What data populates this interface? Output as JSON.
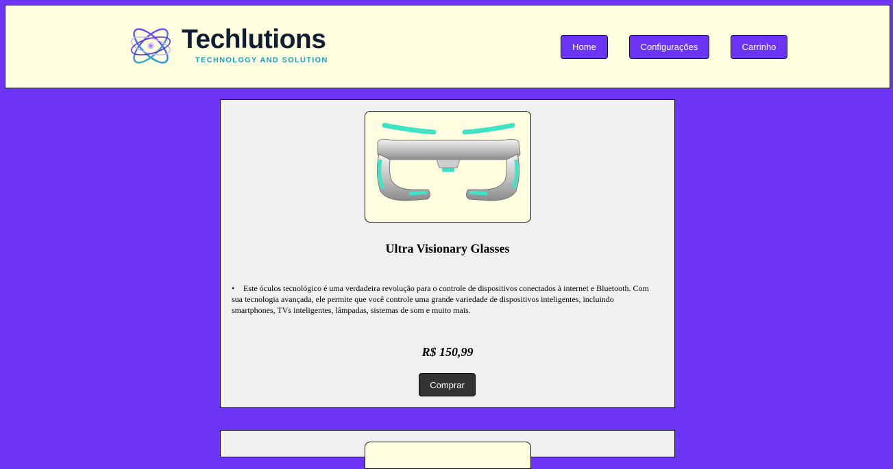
{
  "header": {
    "brand_name": "Techlutions",
    "tagline": "TECHNOLOGY AND SOLUTION",
    "nav": {
      "home": "Home",
      "settings": "Configurações",
      "cart": "Carrinho"
    }
  },
  "products": [
    {
      "image": "smart-glasses-image",
      "title": "Ultra Visionary Glasses",
      "description": "Este óculos tecnológico é uma verdadeira revolução para o controle de dispositivos conectados à internet e Bluetooth. Com sua tecnologia avançada, ele permite que você controle uma grande variedade de dispositivos inteligentes, incluindo smartphones, TVs inteligentes, lâmpadas, sistemas de som e muito mais.",
      "price": "R$ 150,99",
      "buy_label": "Comprar"
    }
  ],
  "colors": {
    "page_background": "#6c35f5",
    "header_background": "#fffde0",
    "card_background": "#f0f0f0",
    "nav_button": "#6c35f5",
    "buy_button": "#333333",
    "brand_text": "#0f1e30",
    "tagline_text": "#1aa0c0"
  }
}
